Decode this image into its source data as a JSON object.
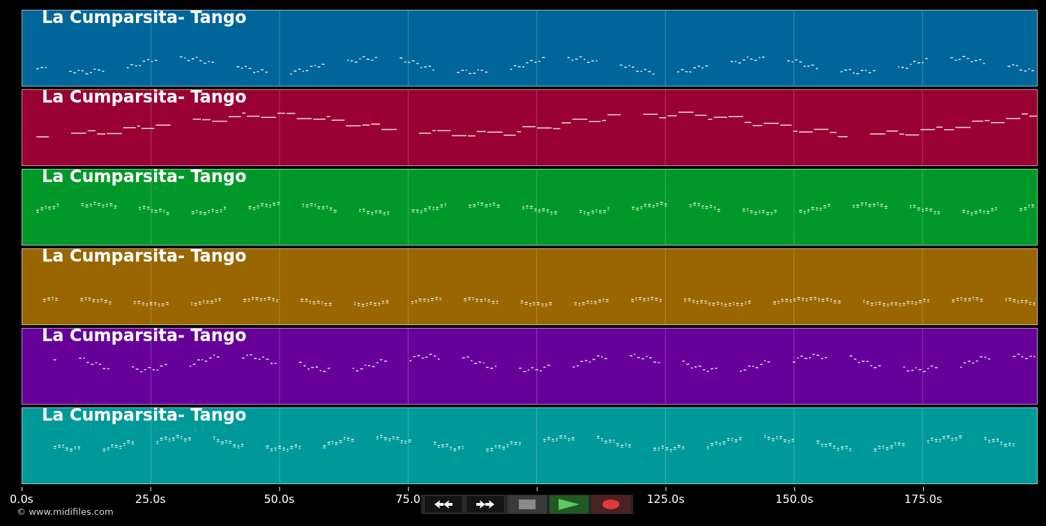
{
  "tracks": [
    {
      "title": "La Cumparsita- Tango",
      "color": "#006699"
    },
    {
      "title": "La Cumparsita- Tango",
      "color": "#990033"
    },
    {
      "title": "La Cumparsita- Tango",
      "color": "#009929"
    },
    {
      "title": "La Cumparsita- Tango",
      "color": "#996600"
    },
    {
      "title": "La Cumparsita- Tango",
      "color": "#660099"
    },
    {
      "title": "La Cumparsita- Tango",
      "color": "#009999"
    }
  ],
  "time_axis": {
    "ticks": [
      "0.0s",
      "25.0s",
      "50.0s",
      "75.0",
      "125.0s",
      "150.0s",
      "175.0s"
    ]
  },
  "credit": "© www.midifiles.com",
  "controls": [
    {
      "kind": "rewind"
    },
    {
      "kind": "forward"
    },
    {
      "kind": "stop"
    },
    {
      "kind": "play"
    },
    {
      "kind": "record"
    }
  ]
}
